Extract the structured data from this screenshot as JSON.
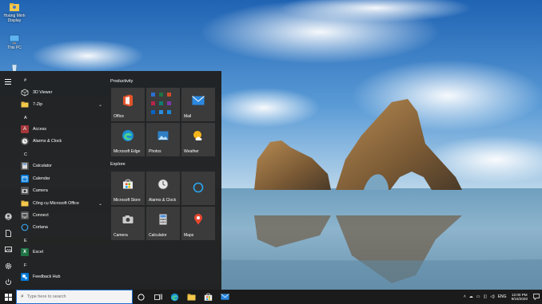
{
  "desktop": {
    "icons": [
      {
        "label": "Hoàng Minh Display",
        "icon": "folder-user-icon"
      },
      {
        "label": "This PC",
        "icon": "computer-icon"
      }
    ]
  },
  "start_menu": {
    "rail": [
      "hamburger-icon",
      "user-icon",
      "document-icon",
      "pictures-icon",
      "settings-icon",
      "power-icon"
    ],
    "letters": [
      "#",
      "A",
      "C",
      "E",
      "F"
    ],
    "apps": [
      {
        "label": "3D Viewer",
        "icon": "cube-icon"
      },
      {
        "label": "7-Zip",
        "icon": "folder-icon"
      },
      {
        "label": "Access",
        "icon": "access-icon"
      },
      {
        "label": "Alarms & Clock",
        "icon": "clock-icon"
      },
      {
        "label": "Calculator",
        "icon": "calculator-icon"
      },
      {
        "label": "Calendar",
        "icon": "calendar-icon"
      },
      {
        "label": "Camera",
        "icon": "camera-icon"
      },
      {
        "label": "Công cụ Microsoft Office",
        "icon": "folder-icon"
      },
      {
        "label": "Connect",
        "icon": "connect-icon"
      },
      {
        "label": "Cortana",
        "icon": "cortana-icon"
      },
      {
        "label": "Excel",
        "icon": "excel-icon"
      },
      {
        "label": "Feedback Hub",
        "icon": "feedback-icon"
      }
    ],
    "groups": [
      {
        "title": "Productivity",
        "tiles": [
          {
            "label": "Office",
            "icon": "office-icon"
          },
          {
            "label": "",
            "icon": "office-apps-icon"
          },
          {
            "label": "Mail",
            "icon": "mail-icon"
          },
          {
            "label": "Microsoft Edge",
            "icon": "edge-icon"
          },
          {
            "label": "Photos",
            "icon": "photos-icon"
          },
          {
            "label": "Weather",
            "icon": "weather-icon"
          }
        ]
      },
      {
        "title": "Explore",
        "tiles": [
          {
            "label": "Microsoft Store",
            "icon": "store-icon"
          },
          {
            "label": "Alarms & Clock",
            "icon": "clock-icon"
          },
          {
            "label": "",
            "icon": "cortana-icon"
          },
          {
            "label": "Camera",
            "icon": "camera-icon"
          },
          {
            "label": "Calculator",
            "icon": "calculator-icon"
          },
          {
            "label": "Maps",
            "icon": "maps-icon"
          }
        ]
      }
    ]
  },
  "taskbar": {
    "search_placeholder": "Type here to search",
    "pinned": [
      "cortana-icon",
      "task-view-icon",
      "edge-icon",
      "file-explorer-icon",
      "store-icon",
      "mail-icon"
    ],
    "tray": {
      "language": "ENG",
      "time": "12:00 PM",
      "date": "9/15/2020"
    }
  },
  "colors": {
    "accent": "#0078d7",
    "tile_bg": "#3b3b3b",
    "menu_bg": "#202020"
  }
}
